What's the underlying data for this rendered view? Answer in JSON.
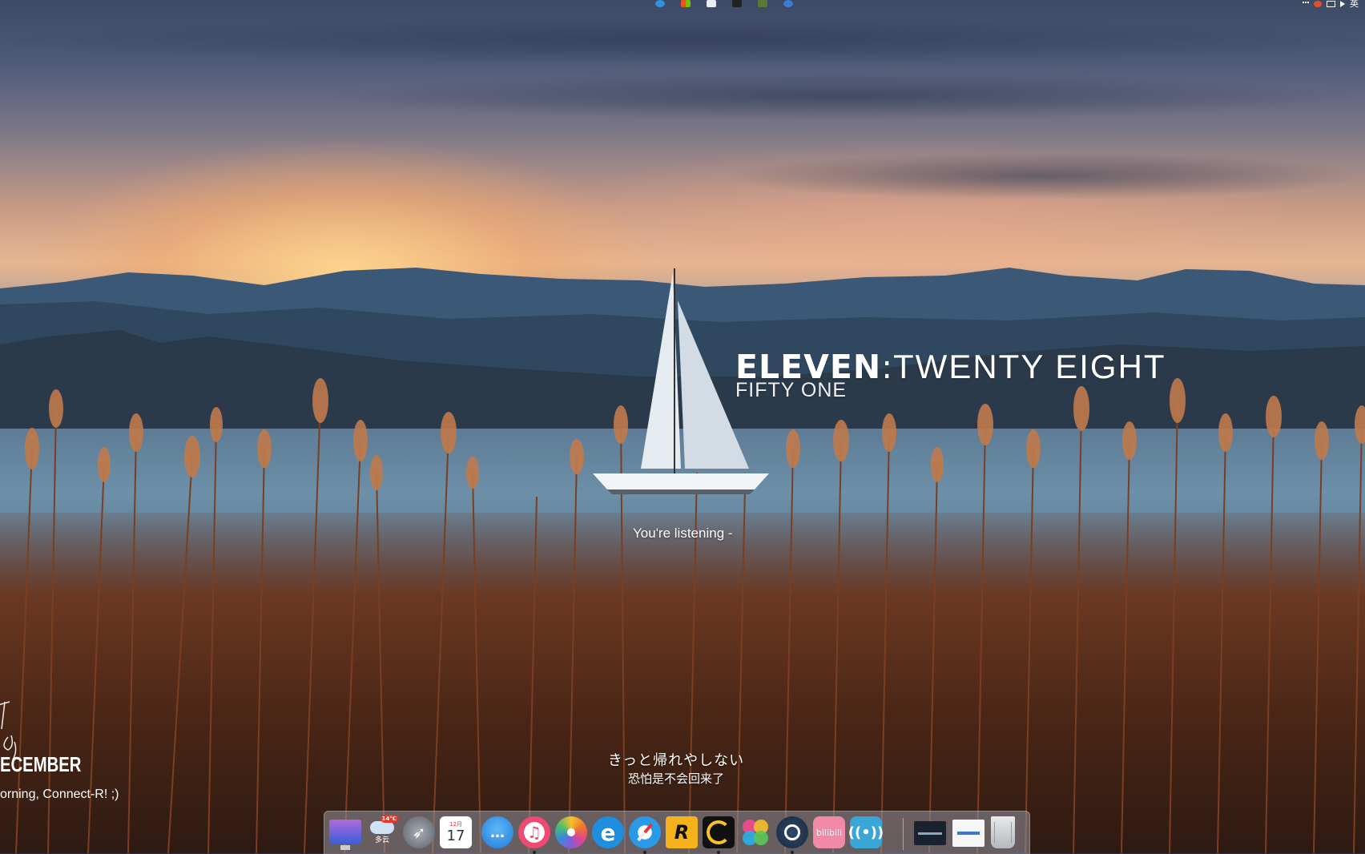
{
  "clock": {
    "hour": "ELEVEN",
    "separator": ":",
    "minute": "TWENTY EIGHT",
    "seconds": "FIFTY ONE"
  },
  "music": {
    "listening": "You're listening -"
  },
  "lyrics": {
    "line1": "きっと帰れやしない",
    "line2": "恐怕是不会回来了"
  },
  "date_widget": {
    "month": "ECEMBER",
    "greeting": "orning, Connect-R! ;)"
  },
  "status_bar": {
    "right_text": "英",
    "tray_icons": [
      "edge-icon",
      "windows-store-icon",
      "mail-icon",
      "terminal-icon",
      "notes-icon",
      "globe-icon"
    ],
    "system_icons": [
      "overflow-icon",
      "app-tray-icon",
      "network-icon",
      "volume-icon"
    ]
  },
  "weather": {
    "temperature": "14°C",
    "condition": "多云"
  },
  "calendar": {
    "month": "12月",
    "day": "17"
  },
  "dock": {
    "items": [
      {
        "name": "imac-finder",
        "label": ""
      },
      {
        "name": "weather-app",
        "label": ""
      },
      {
        "name": "launchpad",
        "label": ""
      },
      {
        "name": "calendar-app",
        "label": ""
      },
      {
        "name": "messages-app",
        "label": ""
      },
      {
        "name": "itunes-app",
        "label": "♫"
      },
      {
        "name": "photos-app",
        "label": ""
      },
      {
        "name": "internet-explorer",
        "label": "e"
      },
      {
        "name": "safari-app",
        "label": ""
      },
      {
        "name": "rockstar-launcher",
        "label": "R"
      },
      {
        "name": "game-app",
        "label": ""
      },
      {
        "name": "color-app",
        "label": ""
      },
      {
        "name": "steam-app",
        "label": ""
      },
      {
        "name": "bilibili-app",
        "label": "bilibili"
      },
      {
        "name": "broadcast-app",
        "label": ""
      },
      {
        "name": "desktop-preview",
        "label": ""
      },
      {
        "name": "window-preview",
        "label": ""
      },
      {
        "name": "trash",
        "label": ""
      }
    ]
  },
  "colors": {
    "dock_bg": "#9a9aa6",
    "itunes": "#f04a72",
    "ie": "#1e8fe0",
    "rockstar": "#f6b21a",
    "bilibili": "#f08aa8",
    "broadcast": "#3aa6d6",
    "steam": "#1b2838"
  }
}
